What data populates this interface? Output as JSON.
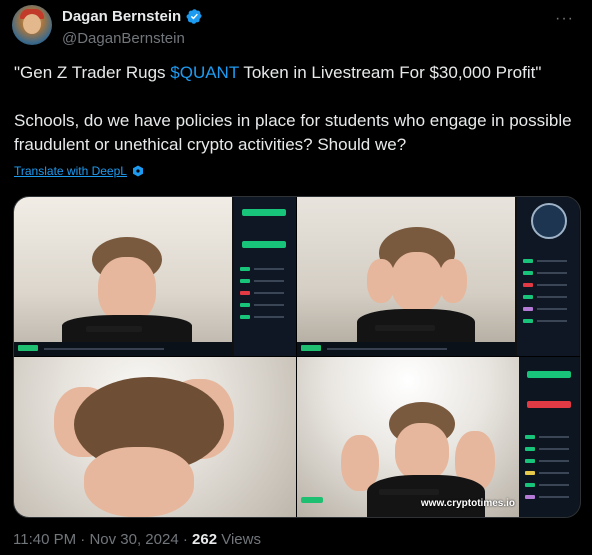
{
  "author": {
    "display_name": "Dagan Bernstein",
    "handle": "@DaganBernstein",
    "verified_color": "#1d9bf0",
    "more_icon": "more-horizontal-icon"
  },
  "tweet": {
    "line1_pre": "\"Gen Z Trader Rugs ",
    "line1_cashtag": "$QUANT",
    "line1_post": " Token in Livestream For $30,000 Profit\"",
    "line2": "Schools, do we have policies in place for students who engage in possible fraudulent or unethical crypto activities? Should we?",
    "translate_label": "Translate with DeepL"
  },
  "media": {
    "watermark": "www.cryptotimes.io"
  },
  "meta": {
    "time": "11:40 PM",
    "separator": "·",
    "date": "Nov 30, 2024",
    "views_count": "262",
    "views_label": "Views"
  },
  "colors": {
    "background": "#000000",
    "text_primary": "#e7e9ea",
    "text_secondary": "#71767b",
    "accent": "#1d9bf0",
    "buy_green": "#18c37a",
    "sell_red": "#e23a45"
  }
}
